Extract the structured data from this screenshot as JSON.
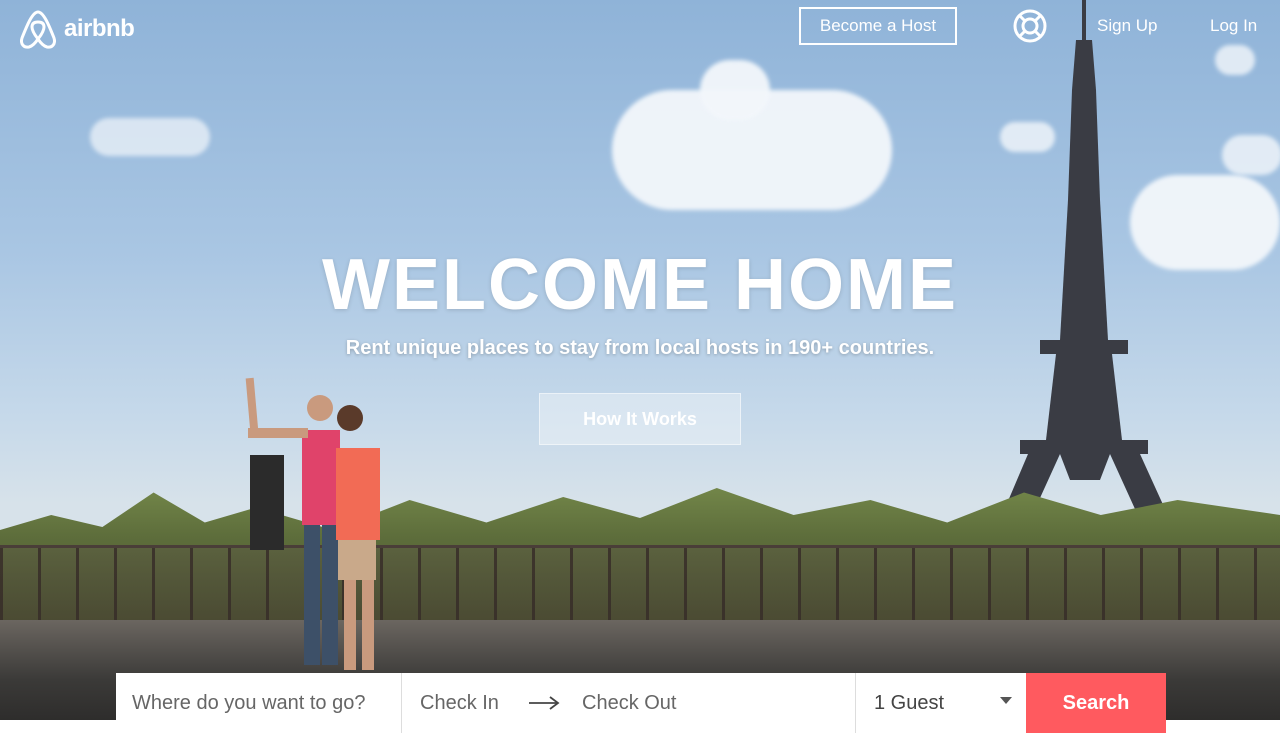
{
  "header": {
    "logo_text": "airbnb",
    "become_host_label": "Become a Host",
    "sign_up_label": "Sign Up",
    "log_in_label": "Log In"
  },
  "hero": {
    "headline": "WELCOME HOME",
    "subheadline": "Rent unique places to stay from local hosts in 190+ countries.",
    "how_it_works_label": "How It Works"
  },
  "search": {
    "where_placeholder": "Where do you want to go?",
    "check_in_label": "Check In",
    "check_out_label": "Check Out",
    "guests_value": "1 Guest",
    "search_label": "Search"
  },
  "colors": {
    "brand": "#ff5a5f"
  },
  "icons": {
    "logo": "airbnb-belo-icon",
    "help": "lifebuoy-icon",
    "arrow": "arrow-right-icon",
    "caret": "caret-down-icon"
  }
}
